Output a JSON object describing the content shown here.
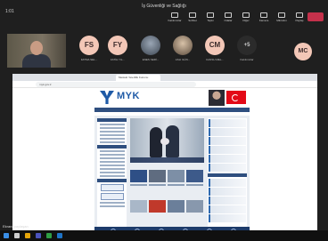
{
  "meeting": {
    "title": "İş Güvenliği ve Sağlığı",
    "timer": "1:01",
    "controls": [
      {
        "label": "Katılımcılar",
        "icon": "people-icon"
      },
      {
        "label": "Sohbet",
        "icon": "chat-icon"
      },
      {
        "label": "Tepki",
        "icon": "reaction-icon"
      },
      {
        "label": "Odalar",
        "icon": "rooms-icon"
      },
      {
        "label": "Diğer",
        "icon": "more-icon"
      },
      {
        "label": "Kamera",
        "icon": "camera-icon"
      },
      {
        "label": "Mikrofon",
        "icon": "mic-icon"
      },
      {
        "label": "Paylaş",
        "icon": "share-icon"
      }
    ],
    "leave_color": "#c4314b"
  },
  "participants": [
    {
      "initials": "FS",
      "name": "FATMA SEL..."
    },
    {
      "initials": "FY",
      "name": "FATİH YIL..."
    },
    {
      "initials": "",
      "name": "ENES SERİ..."
    },
    {
      "initials": "",
      "name": "ASLI GÜN..."
    },
    {
      "initials": "CM",
      "name": "CANSU MEL..."
    },
    {
      "initials": "+5",
      "name": "Katılımcılar"
    }
  ],
  "extra_participant": {
    "initials": "MC"
  },
  "shared_screen": {
    "tab_title": "Mesleki Yeterlilik Kurumu",
    "url": "myk.gov.tr",
    "site_logo": "MYK",
    "sharer": "Ekranı paylaşan"
  },
  "colors": {
    "brand": "#1f5aa6",
    "nav": "#2f4f7f",
    "accent": "#e30a17"
  }
}
